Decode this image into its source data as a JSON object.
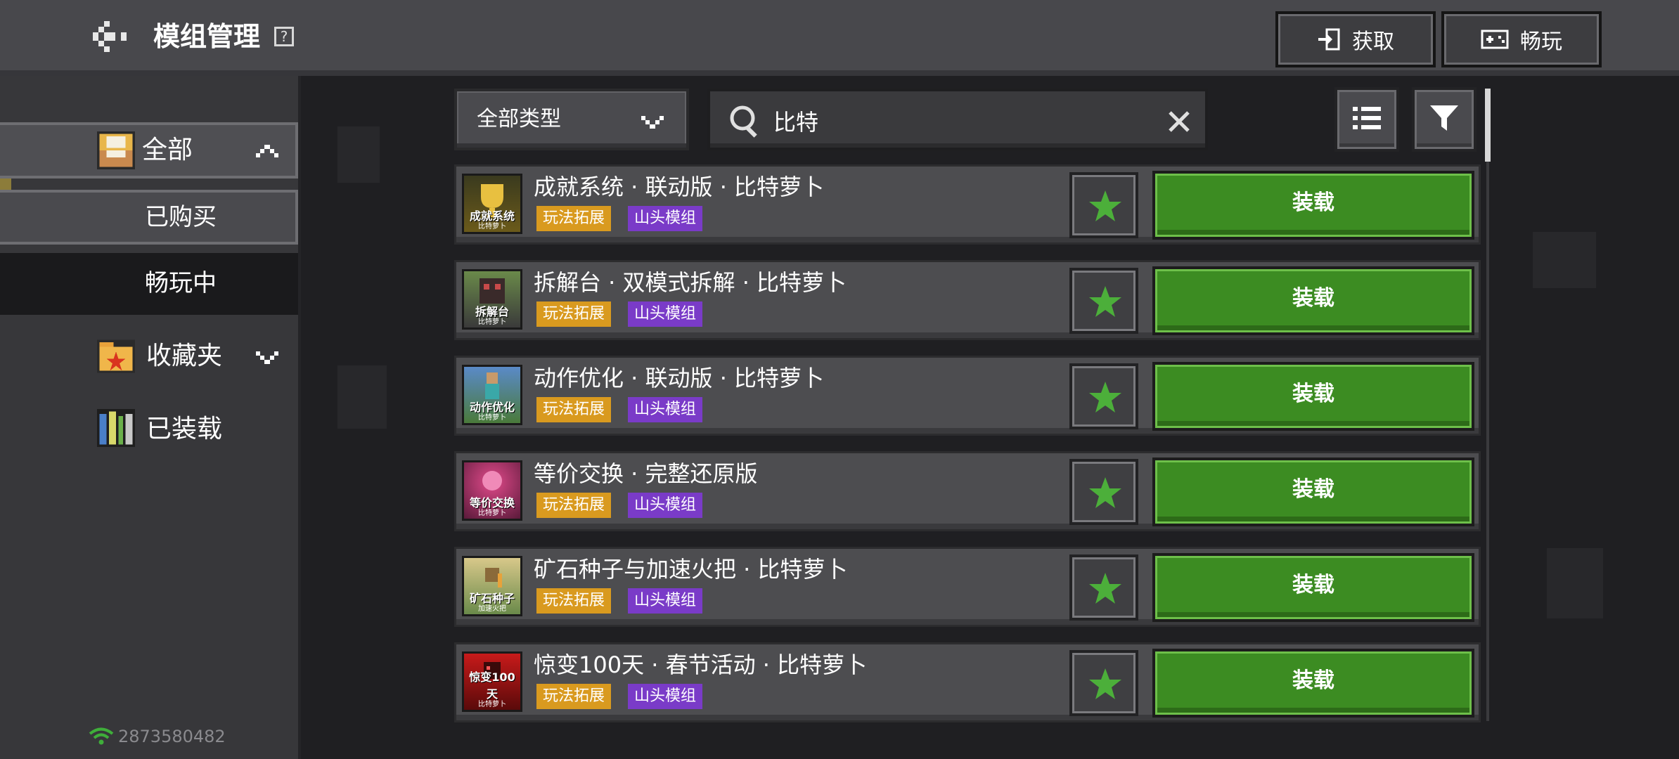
{
  "header": {
    "title": "模组管理",
    "help": "?",
    "get_label": "获取",
    "play_label": "畅玩"
  },
  "sidebar": {
    "items": [
      {
        "label": "全部"
      },
      {
        "label": "已购买"
      },
      {
        "label": "畅玩中"
      },
      {
        "label": "收藏夹"
      },
      {
        "label": "已装载"
      }
    ],
    "user_id": "2873580482"
  },
  "filters": {
    "type_value": "全部类型",
    "search_value": "比特"
  },
  "mods": [
    {
      "title": "成就系统 · 联动版 · 比特萝卜",
      "tags": [
        "玩法拓展",
        "山头模组"
      ],
      "action": "装载",
      "thumb_caption": "成就系统",
      "thumb_sub": "比特萝卜"
    },
    {
      "title": "拆解台 · 双模式拆解 · 比特萝卜",
      "tags": [
        "玩法拓展",
        "山头模组"
      ],
      "action": "装载",
      "thumb_caption": "拆解台",
      "thumb_sub": "比特萝卜"
    },
    {
      "title": "动作优化 · 联动版 · 比特萝卜",
      "tags": [
        "玩法拓展",
        "山头模组"
      ],
      "action": "装载",
      "thumb_caption": "动作优化",
      "thumb_sub": "比特萝卜"
    },
    {
      "title": "等价交换 · 完整还原版",
      "tags": [
        "玩法拓展",
        "山头模组"
      ],
      "action": "装载",
      "thumb_caption": "等价交换",
      "thumb_sub": "比特萝卜"
    },
    {
      "title": "矿石种子与加速火把 · 比特萝卜",
      "tags": [
        "玩法拓展",
        "山头模组"
      ],
      "action": "装载",
      "thumb_caption": "矿石种子",
      "thumb_sub": "加速火把"
    },
    {
      "title": "惊变100天 · 春节活动 · 比特萝卜",
      "tags": [
        "玩法拓展",
        "山头模组"
      ],
      "action": "装载",
      "thumb_caption": "惊变100天",
      "thumb_sub": "比特萝卜"
    }
  ],
  "colors": {
    "accent_green": "#3c8c22",
    "tag_orange": "#d99a1f",
    "tag_purple": "#7a3bc8",
    "star_green": "#4caf3a"
  }
}
